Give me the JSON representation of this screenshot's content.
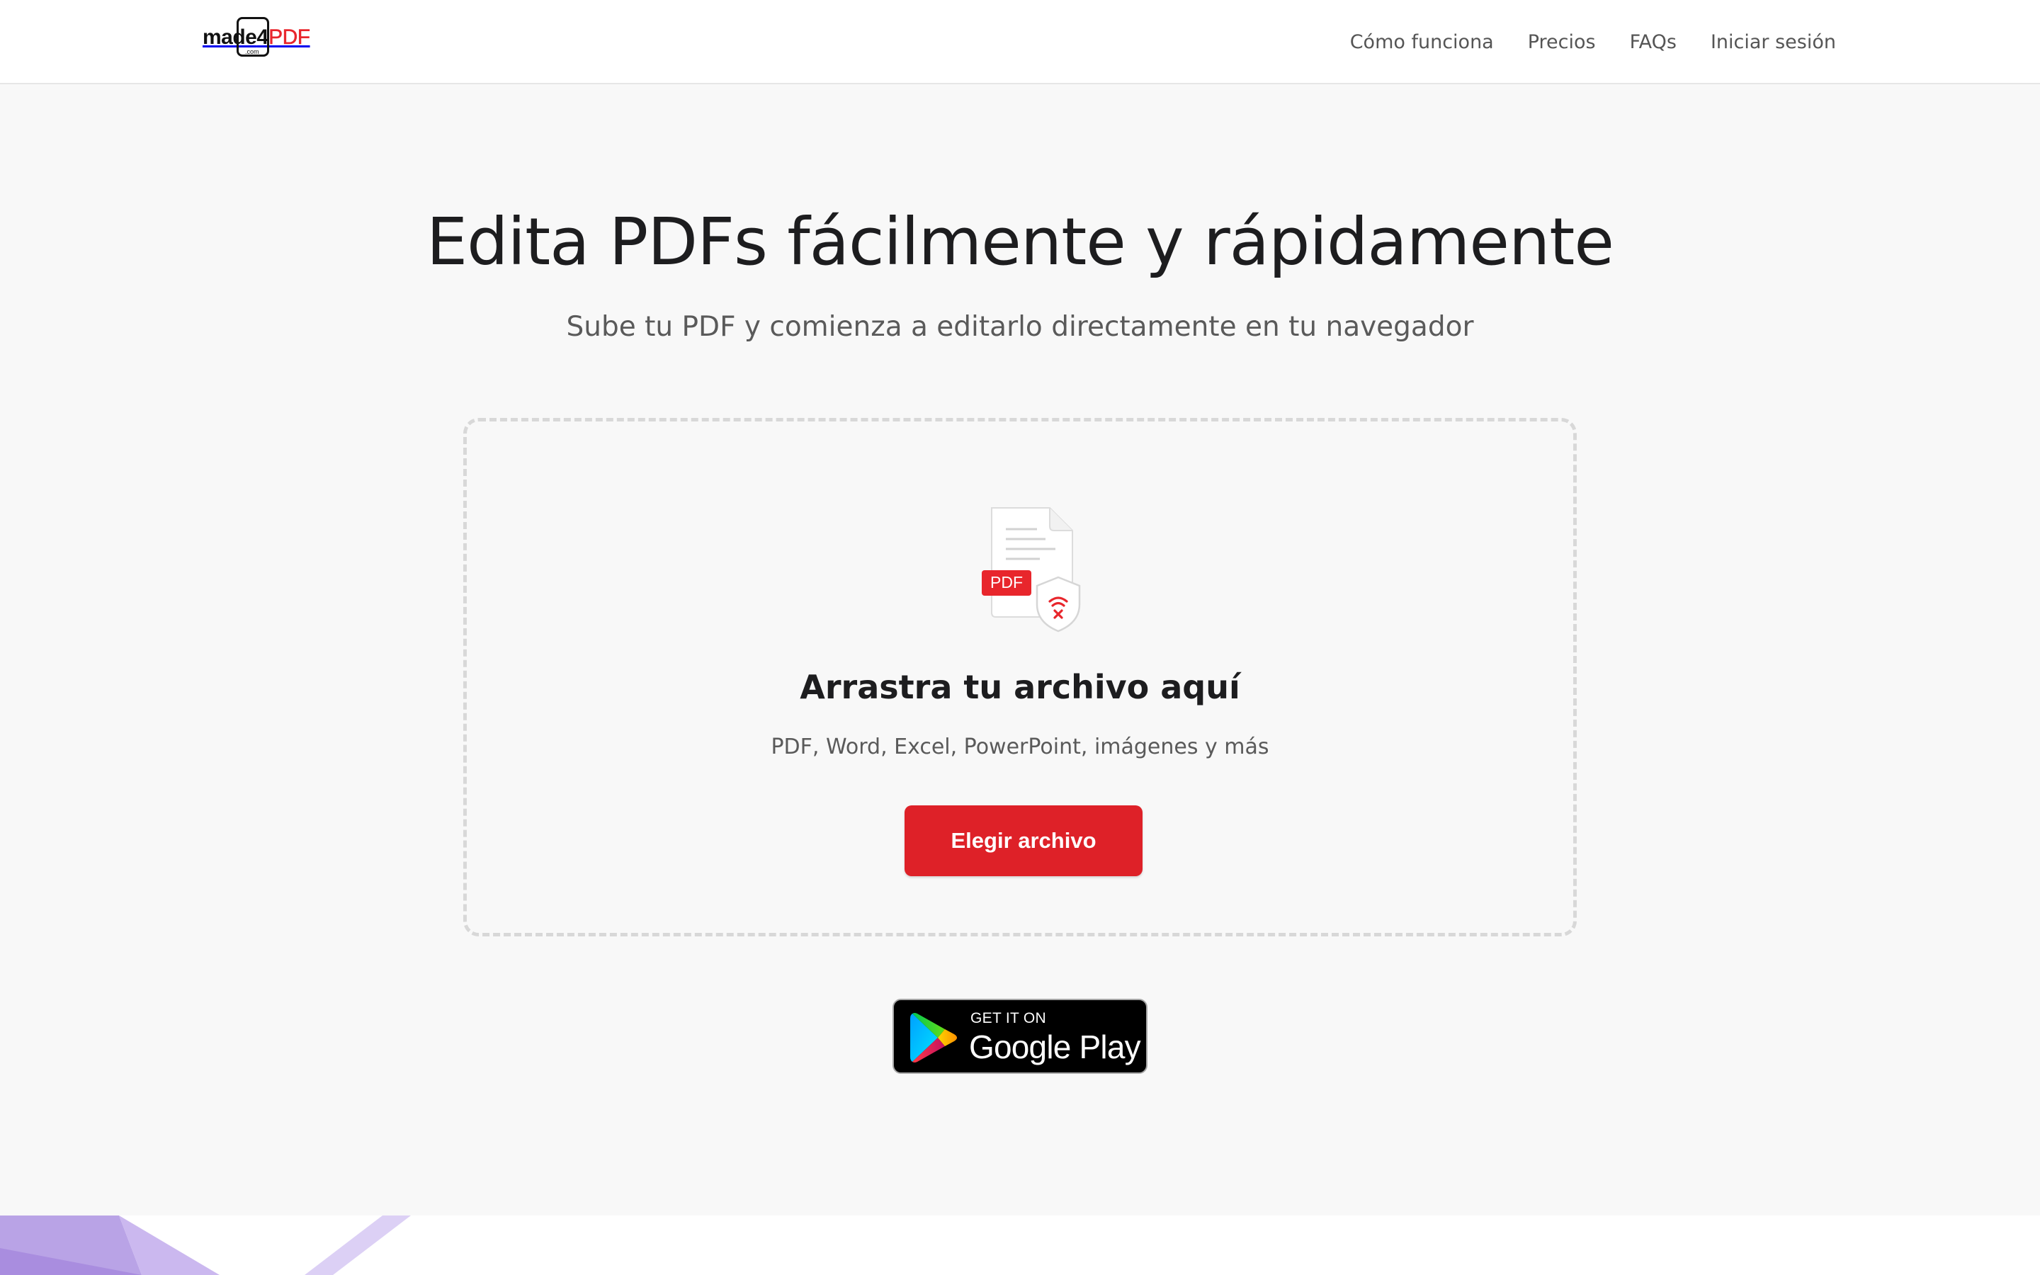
{
  "header": {
    "logo": {
      "made": "made",
      "four": "4",
      "pdf": "PDF",
      "com": ".com"
    },
    "nav": [
      {
        "label": "Cómo funciona"
      },
      {
        "label": "Precios"
      },
      {
        "label": "FAQs"
      },
      {
        "label": "Iniciar sesión"
      }
    ]
  },
  "hero": {
    "title": "Edita PDFs fácilmente y rápidamente",
    "subtitle": "Sube tu PDF y comienza a editarlo directamente en tu navegador"
  },
  "dropzone": {
    "icon_badge": "PDF",
    "title": "Arrastra tu archivo aquí",
    "formats": "PDF, Word, Excel, PowerPoint, imágenes y más",
    "button_label": "Elegir archivo"
  },
  "google_play": {
    "top_text": "GET IT ON",
    "bottom_text": "Google Play"
  },
  "colors": {
    "accent": "#de2128",
    "background": "#f8f8f8",
    "decor_purple": "#b9a3e6"
  }
}
